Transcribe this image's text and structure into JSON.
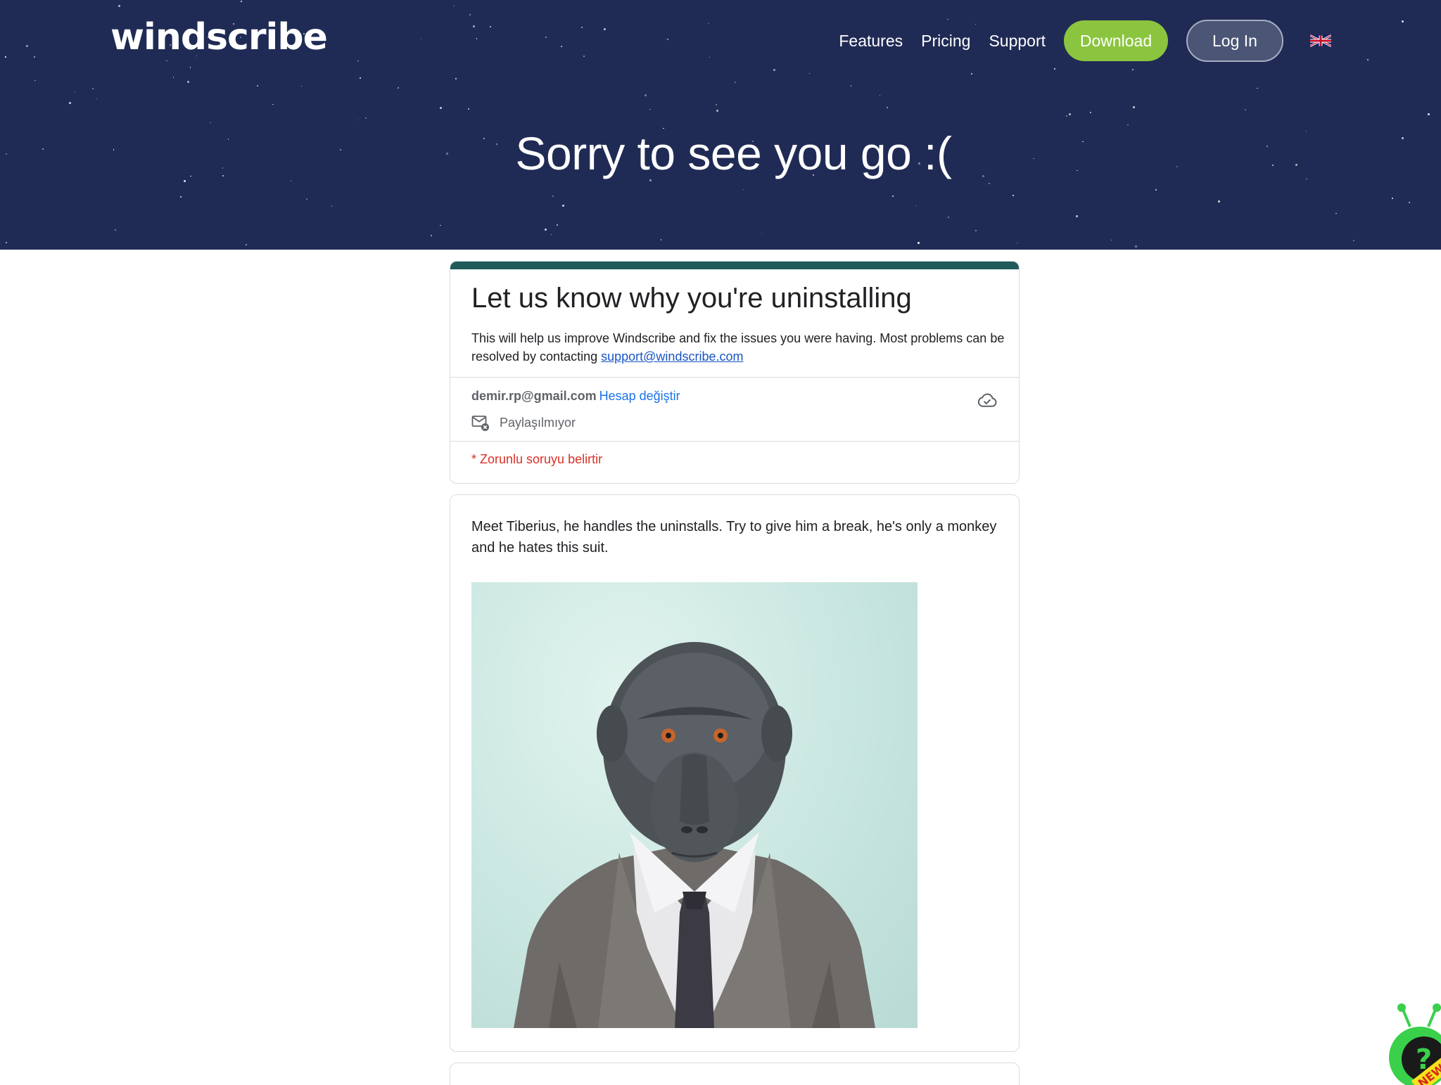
{
  "header": {
    "logo": "windscribe",
    "nav": {
      "features": "Features",
      "pricing": "Pricing",
      "support": "Support",
      "download": "Download",
      "login": "Log In"
    },
    "language_icon": "uk-flag-icon",
    "title": "Sorry to see you go :("
  },
  "form": {
    "title": "Let us know why you're uninstalling",
    "description": "This will help us improve Windscribe and fix the issues you were having. Most problems can be resolved by contacting",
    "support_email": "support@windscribe.com",
    "account_email": "demir.rp@gmail.com",
    "switch_account": "Hesap değiştir",
    "saved_icon": "cloud-check-icon",
    "sharing_icon": "mail-off-icon",
    "sharing_status": "Paylaşılmıyor",
    "required_note": "* Zorunlu soruyu belirtir"
  },
  "section": {
    "text": "Meet Tiberius, he handles the uninstalls. Try to give him a break, he's only a monkey and he hates this suit.",
    "image": "monkey-in-suit-photo"
  },
  "widget": {
    "icon": "help-bot-icon",
    "badge": "NEW"
  },
  "colors": {
    "hero_bg": "#202b55",
    "download_btn": "#8bc53f",
    "login_btn": "#4b5676",
    "form_accent": "#1f5b5a",
    "link": "#1a73e8",
    "required": "#d93025"
  }
}
